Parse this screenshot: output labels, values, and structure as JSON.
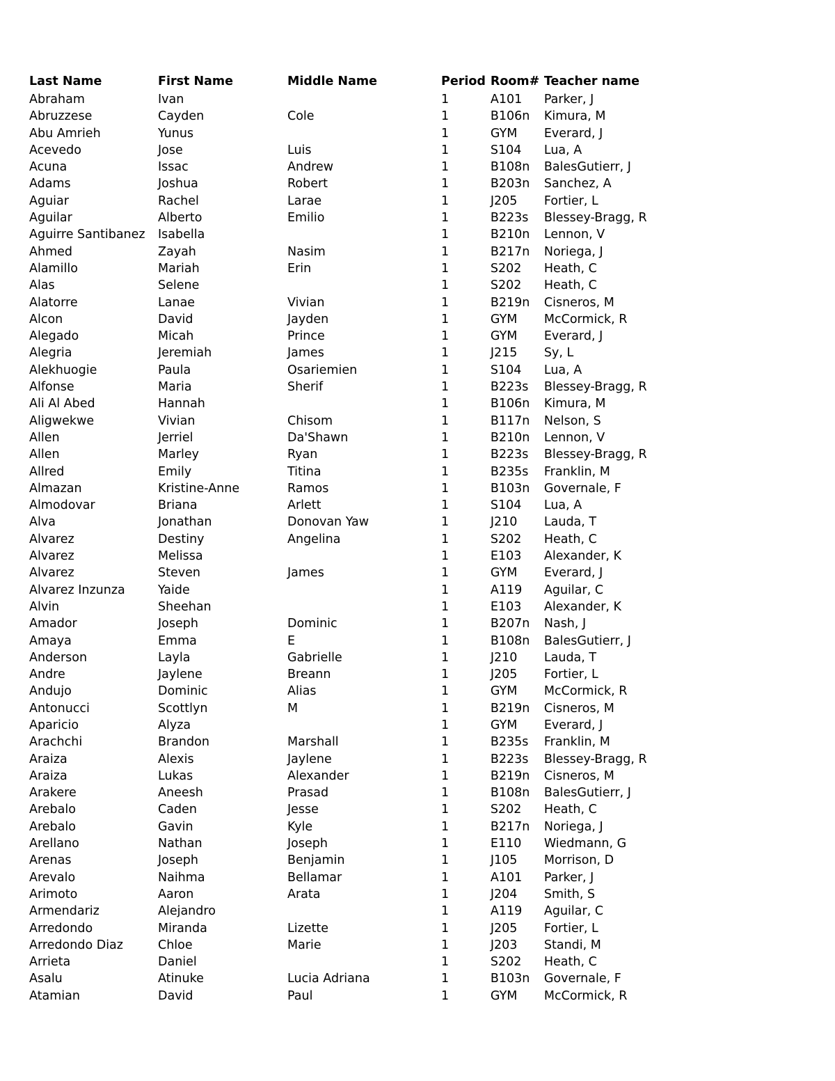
{
  "table": {
    "columns": [
      {
        "key": "last",
        "label": "Last Name"
      },
      {
        "key": "first",
        "label": "First Name"
      },
      {
        "key": "middle",
        "label": "Middle Name"
      },
      {
        "key": "period",
        "label": "Period"
      },
      {
        "key": "room",
        "label": "Room#"
      },
      {
        "key": "teacher",
        "label": "Teacher name"
      }
    ],
    "rows": [
      {
        "last": "Abraham",
        "first": "Ivan",
        "middle": "",
        "period": "1",
        "room": "A101",
        "teacher": "Parker, J"
      },
      {
        "last": "Abruzzese",
        "first": "Cayden",
        "middle": "Cole",
        "period": "1",
        "room": "B106n",
        "teacher": "Kimura, M"
      },
      {
        "last": "Abu Amrieh",
        "first": "Yunus",
        "middle": "",
        "period": "1",
        "room": "GYM",
        "teacher": "Everard, J"
      },
      {
        "last": "Acevedo",
        "first": "Jose",
        "middle": "Luis",
        "period": "1",
        "room": "S104",
        "teacher": "Lua, A"
      },
      {
        "last": "Acuna",
        "first": "Issac",
        "middle": "Andrew",
        "period": "1",
        "room": "B108n",
        "teacher": "BalesGutierr, J"
      },
      {
        "last": "Adams",
        "first": "Joshua",
        "middle": "Robert",
        "period": "1",
        "room": "B203n",
        "teacher": "Sanchez, A"
      },
      {
        "last": "Aguiar",
        "first": "Rachel",
        "middle": "Larae",
        "period": "1",
        "room": "J205",
        "teacher": "Fortier, L"
      },
      {
        "last": "Aguilar",
        "first": "Alberto",
        "middle": "Emilio",
        "period": "1",
        "room": "B223s",
        "teacher": "Blessey-Bragg, R"
      },
      {
        "last": "Aguirre Santibanez",
        "first": "Isabella",
        "middle": "",
        "period": "1",
        "room": "B210n",
        "teacher": "Lennon, V"
      },
      {
        "last": "Ahmed",
        "first": "Zayah",
        "middle": "Nasim",
        "period": "1",
        "room": "B217n",
        "teacher": "Noriega, J"
      },
      {
        "last": "Alamillo",
        "first": "Mariah",
        "middle": "Erin",
        "period": "1",
        "room": "S202",
        "teacher": "Heath, C"
      },
      {
        "last": "Alas",
        "first": "Selene",
        "middle": "",
        "period": "1",
        "room": "S202",
        "teacher": "Heath, C"
      },
      {
        "last": "Alatorre",
        "first": "Lanae",
        "middle": "Vivian",
        "period": "1",
        "room": "B219n",
        "teacher": "Cisneros, M"
      },
      {
        "last": "Alcon",
        "first": "David",
        "middle": "Jayden",
        "period": "1",
        "room": "GYM",
        "teacher": "McCormick, R"
      },
      {
        "last": "Alegado",
        "first": "Micah",
        "middle": "Prince",
        "period": "1",
        "room": "GYM",
        "teacher": "Everard, J"
      },
      {
        "last": "Alegria",
        "first": "Jeremiah",
        "middle": "James",
        "period": "1",
        "room": "J215",
        "teacher": "Sy, L"
      },
      {
        "last": "Alekhuogie",
        "first": "Paula",
        "middle": "Osariemien",
        "period": "1",
        "room": "S104",
        "teacher": "Lua, A"
      },
      {
        "last": "Alfonse",
        "first": "Maria",
        "middle": "Sherif",
        "period": "1",
        "room": "B223s",
        "teacher": "Blessey-Bragg, R"
      },
      {
        "last": "Ali Al Abed",
        "first": "Hannah",
        "middle": "",
        "period": "1",
        "room": "B106n",
        "teacher": "Kimura, M"
      },
      {
        "last": "Aligwekwe",
        "first": "Vivian",
        "middle": "Chisom",
        "period": "1",
        "room": "B117n",
        "teacher": "Nelson, S"
      },
      {
        "last": "Allen",
        "first": "Jerriel",
        "middle": "Da'Shawn",
        "period": "1",
        "room": "B210n",
        "teacher": "Lennon, V"
      },
      {
        "last": "Allen",
        "first": "Marley",
        "middle": "Ryan",
        "period": "1",
        "room": "B223s",
        "teacher": "Blessey-Bragg, R"
      },
      {
        "last": "Allred",
        "first": "Emily",
        "middle": "Titina",
        "period": "1",
        "room": "B235s",
        "teacher": "Franklin, M"
      },
      {
        "last": "Almazan",
        "first": "Kristine-Anne",
        "middle": "Ramos",
        "period": "1",
        "room": "B103n",
        "teacher": "Governale, F"
      },
      {
        "last": "Almodovar",
        "first": "Briana",
        "middle": "Arlett",
        "period": "1",
        "room": "S104",
        "teacher": "Lua, A"
      },
      {
        "last": "Alva",
        "first": "Jonathan",
        "middle": "Donovan Yaw",
        "period": "1",
        "room": "J210",
        "teacher": "Lauda, T"
      },
      {
        "last": "Alvarez",
        "first": "Destiny",
        "middle": "Angelina",
        "period": "1",
        "room": "S202",
        "teacher": "Heath, C"
      },
      {
        "last": "Alvarez",
        "first": "Melissa",
        "middle": "",
        "period": "1",
        "room": "E103",
        "teacher": "Alexander, K"
      },
      {
        "last": "Alvarez",
        "first": "Steven",
        "middle": "James",
        "period": "1",
        "room": "GYM",
        "teacher": "Everard, J"
      },
      {
        "last": "Alvarez Inzunza",
        "first": "Yaide",
        "middle": "",
        "period": "1",
        "room": "A119",
        "teacher": "Aguilar, C"
      },
      {
        "last": "Alvin",
        "first": "Sheehan",
        "middle": "",
        "period": "1",
        "room": "E103",
        "teacher": "Alexander, K"
      },
      {
        "last": "Amador",
        "first": "Joseph",
        "middle": "Dominic",
        "period": "1",
        "room": "B207n",
        "teacher": "Nash, J"
      },
      {
        "last": "Amaya",
        "first": "Emma",
        "middle": "E",
        "period": "1",
        "room": "B108n",
        "teacher": "BalesGutierr, J"
      },
      {
        "last": "Anderson",
        "first": "Layla",
        "middle": "Gabrielle",
        "period": "1",
        "room": "J210",
        "teacher": "Lauda, T"
      },
      {
        "last": "Andre",
        "first": "Jaylene",
        "middle": "Breann",
        "period": "1",
        "room": "J205",
        "teacher": "Fortier, L"
      },
      {
        "last": "Andujo",
        "first": "Dominic",
        "middle": "Alias",
        "period": "1",
        "room": "GYM",
        "teacher": "McCormick, R"
      },
      {
        "last": "Antonucci",
        "first": "Scottlyn",
        "middle": "M",
        "period": "1",
        "room": "B219n",
        "teacher": "Cisneros, M"
      },
      {
        "last": "Aparicio",
        "first": "Alyza",
        "middle": "",
        "period": "1",
        "room": "GYM",
        "teacher": "Everard, J"
      },
      {
        "last": "Arachchi",
        "first": "Brandon",
        "middle": "Marshall",
        "period": "1",
        "room": "B235s",
        "teacher": "Franklin, M"
      },
      {
        "last": "Araiza",
        "first": "Alexis",
        "middle": "Jaylene",
        "period": "1",
        "room": "B223s",
        "teacher": "Blessey-Bragg, R"
      },
      {
        "last": "Araiza",
        "first": "Lukas",
        "middle": "Alexander",
        "period": "1",
        "room": "B219n",
        "teacher": "Cisneros, M"
      },
      {
        "last": "Arakere",
        "first": "Aneesh",
        "middle": "Prasad",
        "period": "1",
        "room": "B108n",
        "teacher": "BalesGutierr, J"
      },
      {
        "last": "Arebalo",
        "first": "Caden",
        "middle": "Jesse",
        "period": "1",
        "room": "S202",
        "teacher": "Heath, C"
      },
      {
        "last": "Arebalo",
        "first": "Gavin",
        "middle": "Kyle",
        "period": "1",
        "room": "B217n",
        "teacher": "Noriega, J"
      },
      {
        "last": "Arellano",
        "first": "Nathan",
        "middle": "Joseph",
        "period": "1",
        "room": "E110",
        "teacher": "Wiedmann, G"
      },
      {
        "last": "Arenas",
        "first": "Joseph",
        "middle": "Benjamin",
        "period": "1",
        "room": "J105",
        "teacher": "Morrison, D"
      },
      {
        "last": "Arevalo",
        "first": "Naihma",
        "middle": "Bellamar",
        "period": "1",
        "room": "A101",
        "teacher": "Parker, J"
      },
      {
        "last": "Arimoto",
        "first": "Aaron",
        "middle": "Arata",
        "period": "1",
        "room": "J204",
        "teacher": "Smith, S"
      },
      {
        "last": "Armendariz",
        "first": "Alejandro",
        "middle": "",
        "period": "1",
        "room": "A119",
        "teacher": "Aguilar, C"
      },
      {
        "last": "Arredondo",
        "first": "Miranda",
        "middle": "Lizette",
        "period": "1",
        "room": "J205",
        "teacher": "Fortier, L"
      },
      {
        "last": "Arredondo Diaz",
        "first": "Chloe",
        "middle": "Marie",
        "period": "1",
        "room": "J203",
        "teacher": "Standi, M"
      },
      {
        "last": "Arrieta",
        "first": "Daniel",
        "middle": "",
        "period": "1",
        "room": "S202",
        "teacher": "Heath, C"
      },
      {
        "last": "Asalu",
        "first": "Atinuke",
        "middle": "Lucia Adriana",
        "period": "1",
        "room": "B103n",
        "teacher": "Governale, F"
      },
      {
        "last": "Atamian",
        "first": "David",
        "middle": "Paul",
        "period": "1",
        "room": "GYM",
        "teacher": "McCormick, R"
      }
    ]
  }
}
